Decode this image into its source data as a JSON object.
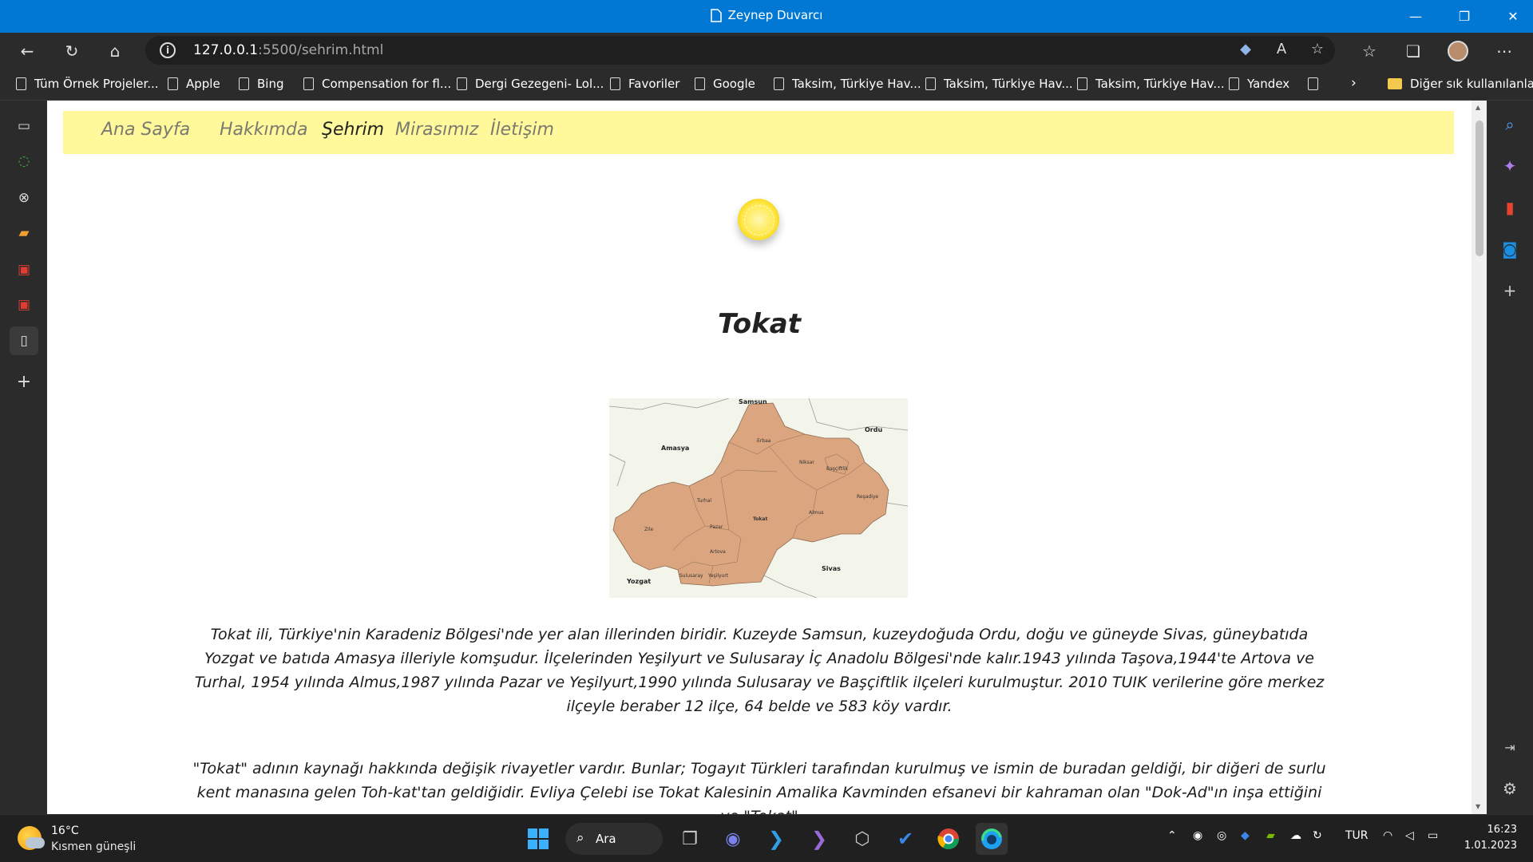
{
  "window": {
    "title": "Zeynep Duvarcı"
  },
  "address_bar": {
    "url_host": "127.0.0.1",
    "url_path": ":5500/sehrim.html"
  },
  "bookmarks": [
    "Tüm Örnek Projeler...",
    "Apple",
    "Bing",
    "Compensation for fl...",
    "Dergi Gezegeni- Lol...",
    "Favoriler",
    "Google",
    "Taksim, Türkiye Hav...",
    "Taksim, Türkiye Hav...",
    "Taksim, Türkiye Hav...",
    "Yandex"
  ],
  "other_bookmarks": "Diğer sık kullanılanlar",
  "nav": {
    "items": [
      "Ana Sayfa",
      "Hakkımda",
      "Şehrim",
      "Mirasımız",
      "İletişim"
    ],
    "active": "Şehrim"
  },
  "page": {
    "title": "Tokat",
    "paragraph1": "Tokat ili, Türkiye'nin Karadeniz Bölgesi'nde yer alan illerinden biridir. Kuzeyde Samsun, kuzeydoğuda Ordu, doğu ve güneyde Sivas, güneybatıda Yozgat ve batıda Amasya illeriyle komşudur. İlçelerinden Yeşilyurt ve Sulusaray İç Anadolu Bölgesi'nde kalır.1943 yılında Taşova,1944'te Artova ve Turhal, 1954 yılında Almus,1987 yılında Pazar ve Yeşilyurt,1990 yılında Sulusaray ve Başçiftlik ilçeleri kurulmuştur. 2010 TUIK verilerine göre merkez ilçeyle beraber 12 ilçe, 64 belde ve 583 köy vardır.",
    "paragraph2": "\"Tokat\" adının kaynağı hakkında değişik rivayetler vardır. Bunlar; Togayıt Türkleri tarafından kurulmuş ve ismin de buradan geldiği, bir diğeri de surlu kent manasına gelen Toh-kat'tan geldiğidir. Evliya Çelebi ise Tokat Kalesinin Amalika Kavminden efsanevi bir kahraman olan \"Dok-Ad\"ın inşa ettiğini ve \"Tokat\""
  },
  "map": {
    "neighbors": [
      "Samsun",
      "Ordu",
      "Amasya",
      "Sivas",
      "Yozgat"
    ],
    "districts": [
      "Erbaa",
      "Niksar",
      "Başçiftlik",
      "Reşadiye",
      "Turhal",
      "Almus",
      "Tokat",
      "Zile",
      "Pazar",
      "Artova",
      "Sulusaray",
      "Yeşilyurt"
    ],
    "fill_color": "#dba67f"
  },
  "taskbar": {
    "temperature": "16°C",
    "weather": "Kısmen güneşli",
    "search_label": "Ara",
    "language": "TUR",
    "time": "16:23",
    "date": "1.01.2023"
  },
  "colors": {
    "titlebar": "#0078d4",
    "navbar": "#fff99c",
    "map_region": "#dba67f"
  }
}
